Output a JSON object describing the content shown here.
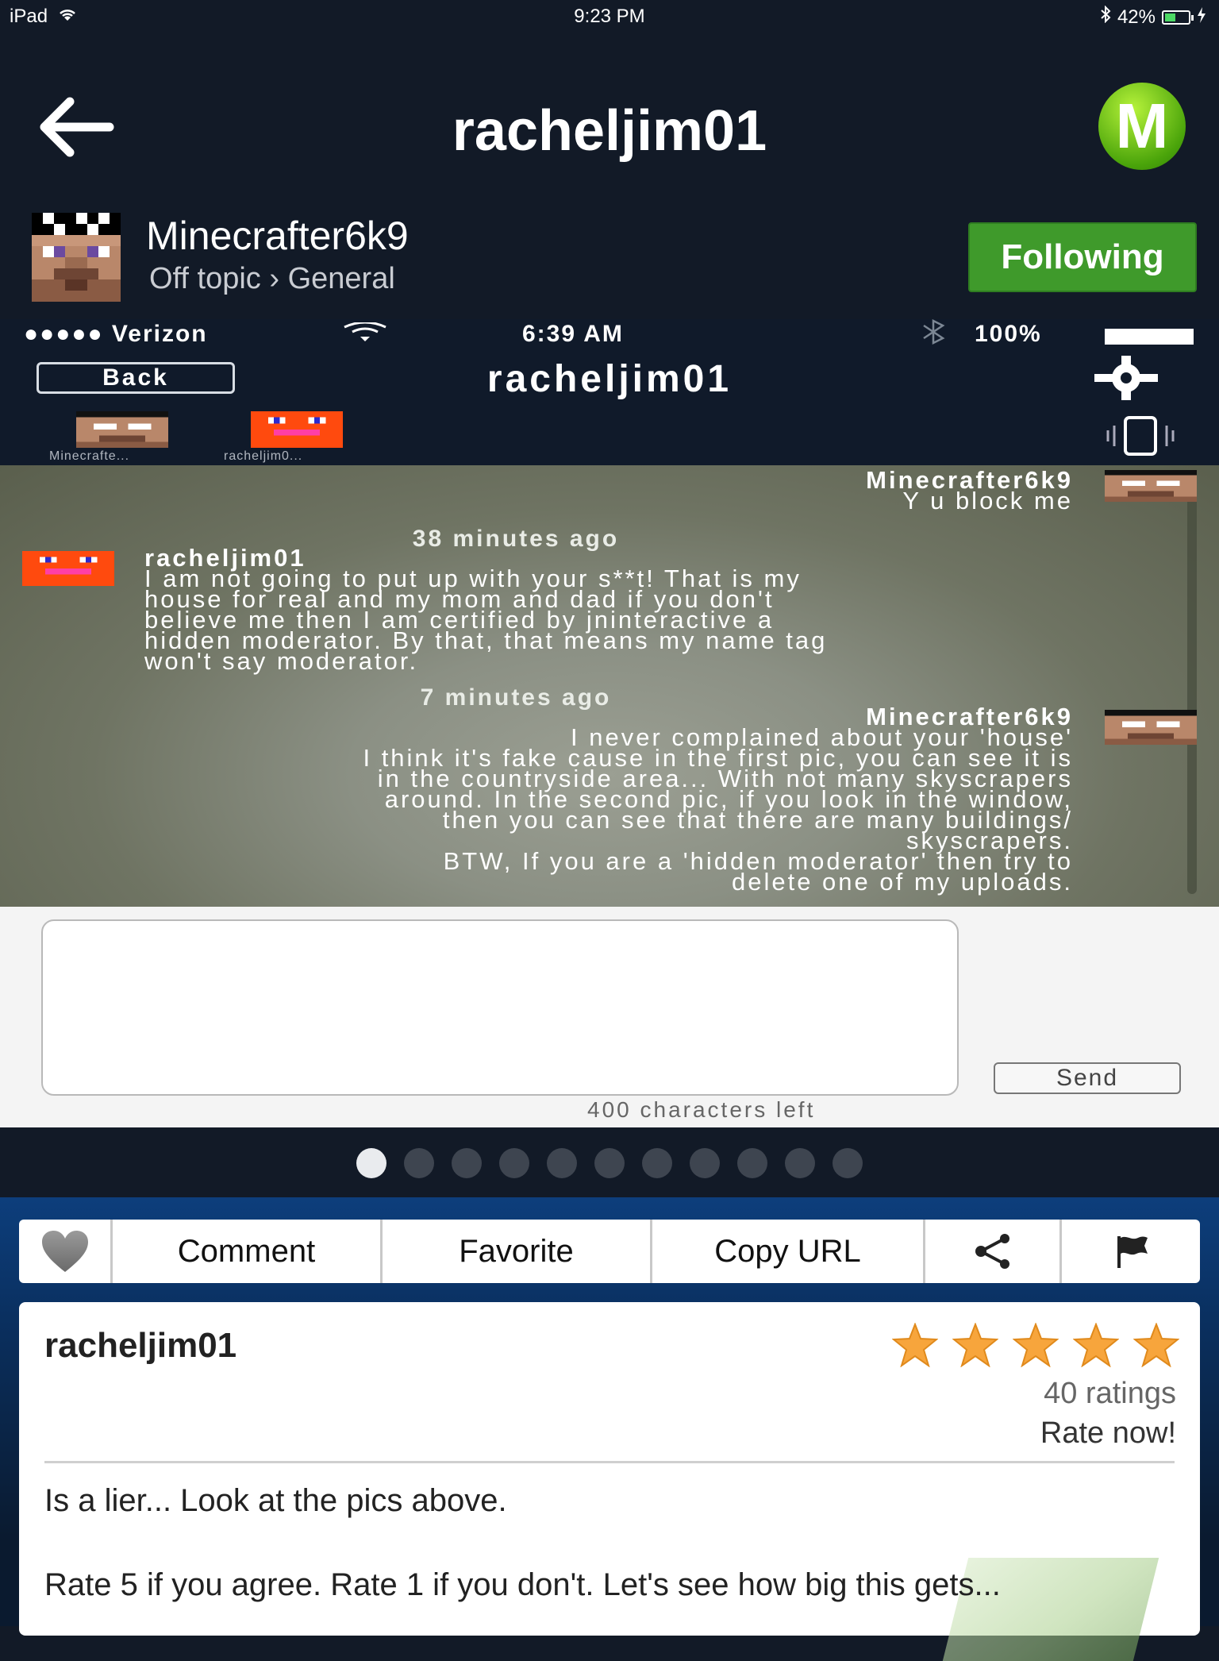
{
  "status_bar": {
    "device": "iPad",
    "time": "9:23 PM",
    "battery": "42%"
  },
  "nav": {
    "title": "racheljim01",
    "logo_letter": "M"
  },
  "author": {
    "name": "Minecrafter6k9",
    "category": "Off topic › General",
    "follow_label": "Following"
  },
  "screenshot": {
    "status": {
      "carrier": "●●●●● Verizon",
      "time": "6:39 AM",
      "battery": "100%"
    },
    "back_label": "Back",
    "title": "racheljim01",
    "participants": [
      "Minecrafte...",
      "racheljim0..."
    ],
    "messages": [
      {
        "sender": "Minecrafter6k9",
        "text": "Y u block me"
      },
      {
        "time": "38 minutes ago"
      },
      {
        "sender": "racheljim01",
        "lines": [
          "I am not going to put up with your s**t! That is my",
          "house for real and my mom and dad if you don't",
          "believe me then I am certified by jninteractive a",
          "hidden moderator. By that, that means my name tag",
          "won't say moderator."
        ]
      },
      {
        "time": "7 minutes ago"
      },
      {
        "sender": "Minecrafter6k9",
        "lines": [
          "I never complained about your 'house'",
          "I think it's fake cause in the first pic, you can see it is",
          "in the countryside area... With not many skyscrapers",
          "around. In the second pic, if you look in the window,",
          "then you can see that there are many buildings/",
          "skyscrapers.",
          "BTW, If you are a 'hidden moderator' then try to",
          "delete one of my uploads."
        ]
      }
    ],
    "send_label": "Send",
    "chars_left": "400 characters left"
  },
  "pager": {
    "count": 11,
    "active": 0
  },
  "actions": {
    "comment": "Comment",
    "favorite": "Favorite",
    "copy_url": "Copy URL"
  },
  "card": {
    "user": "racheljim01",
    "rating": 5,
    "ratings_count": "40 ratings",
    "rate_now": "Rate now!",
    "description_line1": "Is a lier... Look at the pics above.",
    "description_line2": "Rate 5 if you agree. Rate 1 if you don't. Let's see how big this gets..."
  },
  "colors": {
    "background": "#121a27",
    "follow_green": "#3f9a2b",
    "star_orange": "#f7a53c"
  }
}
